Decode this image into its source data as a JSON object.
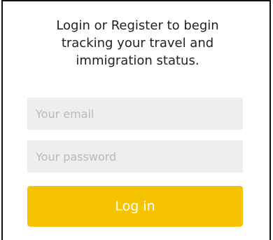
{
  "intro": {
    "line1": "Login or Register to begin",
    "line2": "tracking your travel and",
    "line3": "immigration status."
  },
  "form": {
    "email_placeholder": "Your email",
    "email_value": "",
    "password_placeholder": "Your password",
    "password_value": "",
    "login_label": "Log in"
  },
  "colors": {
    "accent": "#f5c300",
    "field_background": "#eeeeee",
    "placeholder": "#b9b9b9",
    "text": "#222222"
  }
}
